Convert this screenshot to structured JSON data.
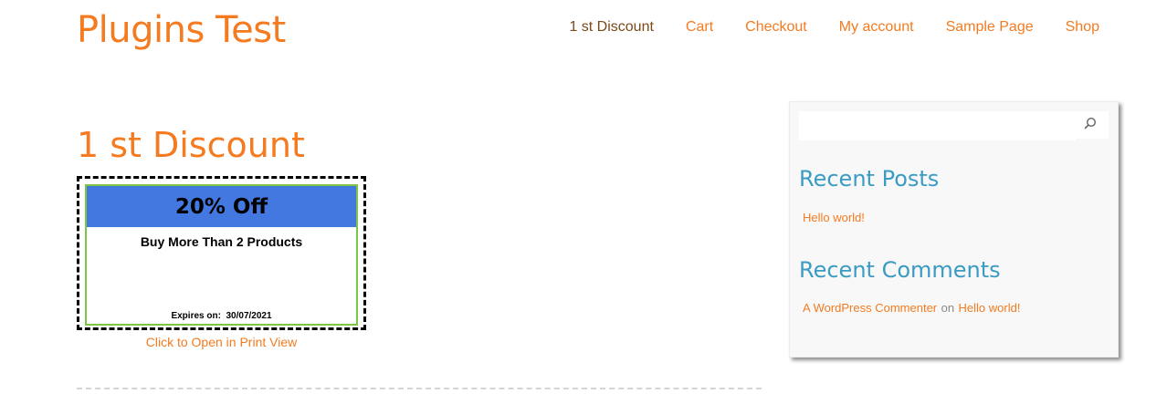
{
  "site": {
    "title": "Plugins Test"
  },
  "nav": {
    "items": [
      {
        "label": "1 st Discount"
      },
      {
        "label": "Cart"
      },
      {
        "label": "Checkout"
      },
      {
        "label": "My account"
      },
      {
        "label": "Sample Page"
      },
      {
        "label": "Shop"
      }
    ]
  },
  "page": {
    "title": "1 st Discount"
  },
  "coupon": {
    "headline": "20% Off",
    "description": "Buy More Than 2 Products",
    "expires_label": "Expires on:",
    "expires_date": "30/07/2021",
    "print_link": "Click to Open in Print View",
    "colors": {
      "header": "#4378e0",
      "border": "#7cc644"
    }
  },
  "sidebar": {
    "search": {
      "placeholder": ""
    },
    "recent_posts": {
      "title": "Recent Posts",
      "items": [
        {
          "label": "Hello world!"
        }
      ]
    },
    "recent_comments": {
      "title": "Recent Comments",
      "items": [
        {
          "author": "A WordPress Commenter",
          "connector": "on",
          "post": "Hello world!"
        }
      ]
    }
  },
  "colors": {
    "accent": "#f47b20",
    "widget_title": "#3a9bc4"
  }
}
